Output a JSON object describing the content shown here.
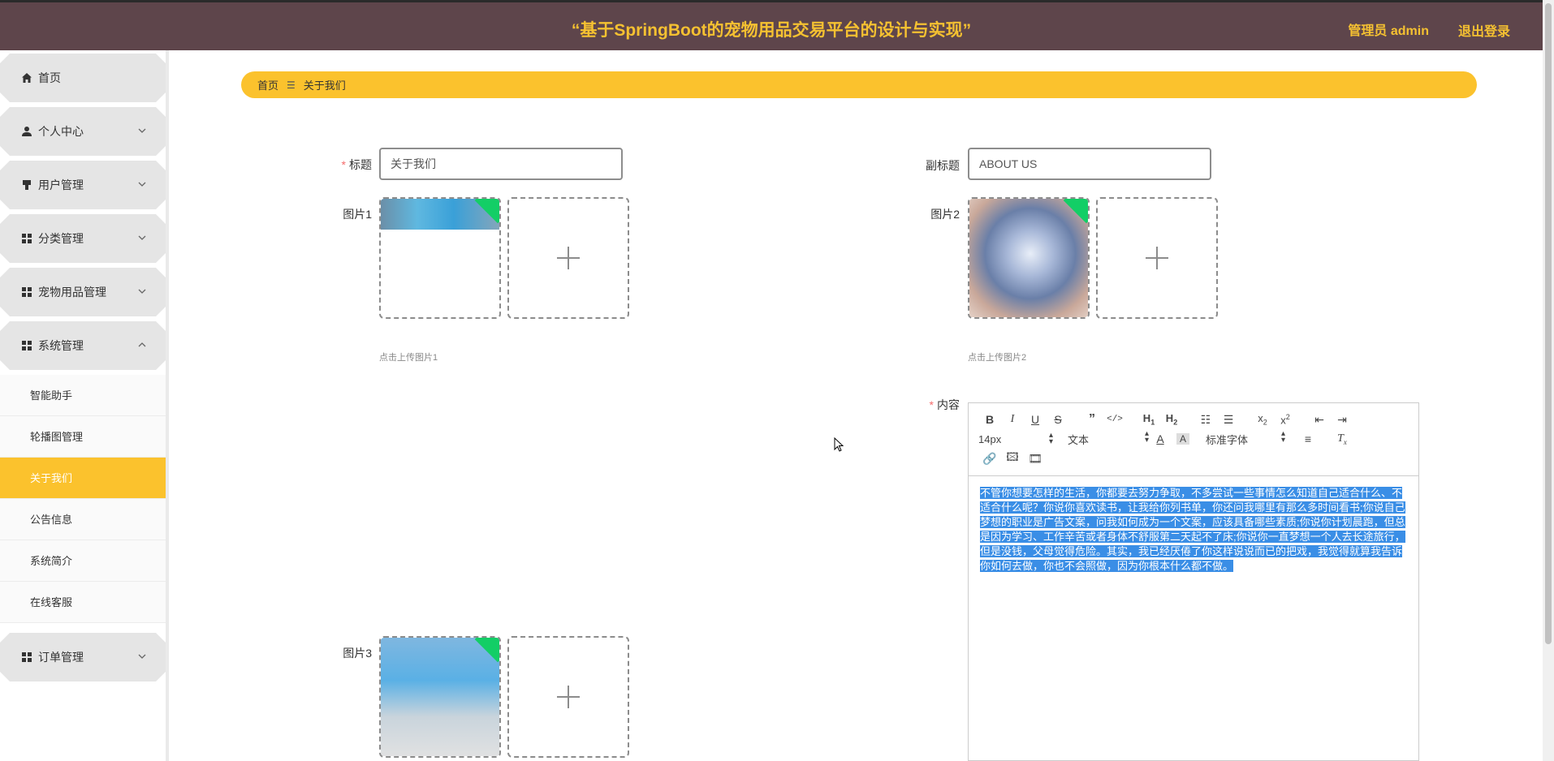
{
  "header": {
    "title": "“基于SpringBoot的宠物用品交易平台的设计与实现”",
    "user": "管理员 admin",
    "logout": "退出登录"
  },
  "sidebar": {
    "items": [
      {
        "label": "首页",
        "icon": "home-icon"
      },
      {
        "label": "个人中心",
        "icon": "user-icon"
      },
      {
        "label": "用户管理",
        "icon": "user-manage-icon"
      },
      {
        "label": "分类管理",
        "icon": "grid-icon"
      },
      {
        "label": "宠物用品管理",
        "icon": "grid-icon"
      },
      {
        "label": "系统管理",
        "icon": "grid-icon"
      }
    ],
    "submenu": [
      {
        "label": "智能助手"
      },
      {
        "label": "轮播图管理"
      },
      {
        "label": "关于我们"
      },
      {
        "label": "公告信息"
      },
      {
        "label": "系统简介"
      },
      {
        "label": "在线客服"
      }
    ],
    "last": {
      "label": "订单管理",
      "icon": "grid-icon"
    }
  },
  "breadcrumb": {
    "home": "首页",
    "current": "关于我们"
  },
  "form": {
    "title_label": "标题",
    "title_value": "关于我们",
    "subtitle_label": "副标题",
    "subtitle_value": "ABOUT US",
    "pic1_label": "图片1",
    "pic1_hint": "点击上传图片1",
    "pic2_label": "图片2",
    "pic2_hint": "点击上传图片2",
    "pic3_label": "图片3",
    "content_label": "内容"
  },
  "editor": {
    "font_size": "14px",
    "text_type": "文本",
    "font_family": "标准字体",
    "content": "不管你想要怎样的生活，你都要去努力争取，不多尝试一些事情怎么知道自己适合什么、不适合什么呢？你说你喜欢读书，让我给你列书单，你还问我哪里有那么多时间看书;你说自己梦想的职业是广告文案，问我如何成为一个文案，应该具备哪些素质;你说你计划晨跑，但总是因为学习、工作辛苦或者身体不舒服第二天起不了床;你说你一直梦想一个人去长途旅行，但是没钱，父母觉得危险。其实，我已经厌倦了你这样说说而已的把戏，我觉得就算我告诉你如何去做，你也不会照做，因为你根本什么都不做。"
  },
  "colors": {
    "header_bg": "#5e454b",
    "accent": "#fbc22d",
    "title_text": "#f5c131",
    "selection": "#3a8ee6"
  }
}
